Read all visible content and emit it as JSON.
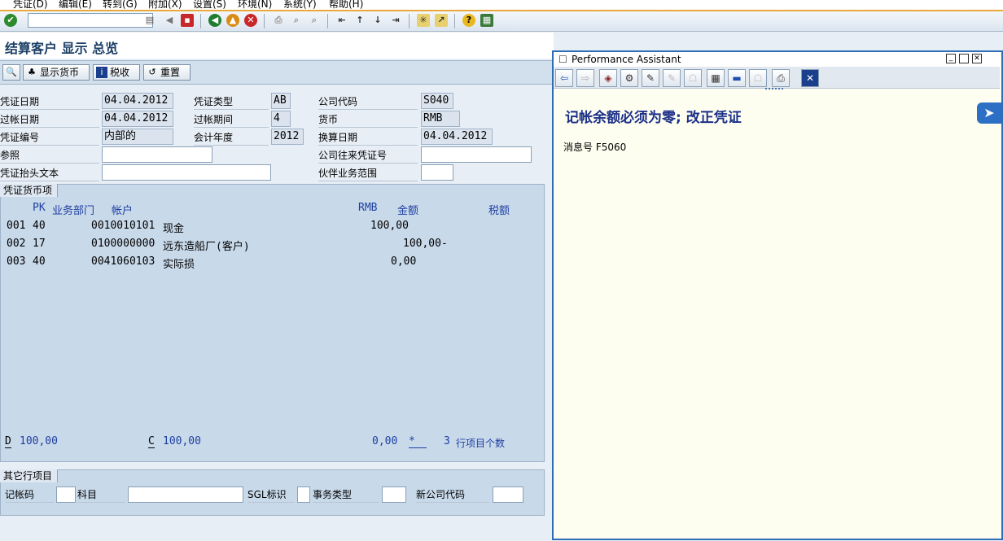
{
  "menu": [
    "凭证(D)",
    "编辑(E)",
    "转到(G)",
    "附加(X)",
    "设置(S)",
    "环境(N)",
    "系统(Y)",
    "帮助(H)"
  ],
  "page_title": "结算客户 显示 总览",
  "app_toolbar": {
    "display_currency": "显示货币",
    "tax": "税收",
    "reset": "重置"
  },
  "header": {
    "doc_date_label": "凭证日期",
    "doc_date": "04.04.2012",
    "doc_type_label": "凭证类型",
    "doc_type": "AB",
    "company_code_label": "公司代码",
    "company_code": "S040",
    "posting_date_label": "过帐日期",
    "posting_date": "04.04.2012",
    "period_label": "过帐期间",
    "period": "4",
    "currency_label": "货币",
    "currency": "RMB",
    "doc_number_label": "凭证编号",
    "doc_number": "内部的",
    "fiscal_year_label": "会计年度",
    "fiscal_year": "2012",
    "translation_date_label": "换算日期",
    "translation_date": "04.04.2012",
    "reference_label": "参照",
    "reference": "",
    "intercompany_label": "公司往来凭证号",
    "intercompany": "",
    "header_text_label": "凭证抬头文本",
    "header_text": "",
    "partner_ba_label": "伙伴业务范围",
    "partner_ba": ""
  },
  "items": {
    "section_label": "凭证货币项",
    "col_pk": "PK",
    "col_bus_area": "业务部门",
    "col_account": "帐户",
    "col_currency": "RMB",
    "col_amount": "金额",
    "col_tax": "税额",
    "rows": [
      {
        "no": "001",
        "pk": "40",
        "account": "0010010101",
        "name": "现金",
        "amount": "100,00"
      },
      {
        "no": "002",
        "pk": "17",
        "account": "0100000000",
        "name": "远东造船厂(客户)",
        "amount": "100,00-"
      },
      {
        "no": "003",
        "pk": "40",
        "account": "0041060103",
        "name": "实际损",
        "amount": "0,00"
      }
    ],
    "debit_label": "D",
    "debit_total": "100,00",
    "credit_label": "C",
    "credit_total": "100,00",
    "balance": "0,00",
    "balance_flag": "*",
    "item_count": "3",
    "item_count_label": "行项目个数"
  },
  "other_item": {
    "section_label": "其它行项目",
    "posting_key_label": "记帐码",
    "account_label": "科目",
    "sgl_label": "SGL标识",
    "trans_type_label": "事务类型",
    "new_company_label": "新公司代码"
  },
  "performance_assistant": {
    "title": "Performance Assistant",
    "message": "记帐余额必须为零; 改正凭证",
    "msg_no_label": "消息号",
    "msg_no": "F5060"
  }
}
